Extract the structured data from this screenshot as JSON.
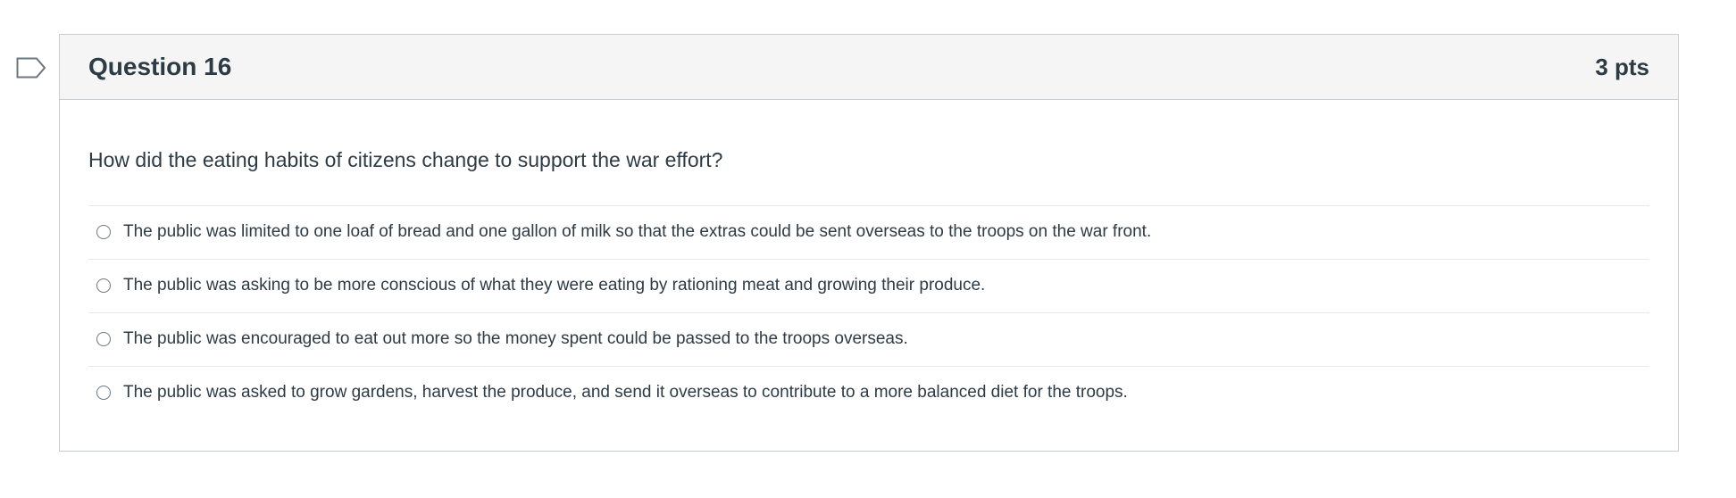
{
  "question": {
    "title": "Question 16",
    "points": "3 pts",
    "text": "How did the eating habits of citizens change to support the war effort?",
    "flag_icon": "flag-outline-icon",
    "answers": [
      {
        "label": "The public was limited to one loaf of bread and one gallon of milk so that the extras could be sent overseas to the troops on the war front.",
        "selected": false
      },
      {
        "label": "The public was asking to be more conscious of what they were eating by rationing meat and growing their produce.",
        "selected": false
      },
      {
        "label": "The public was encouraged to eat out more so the money spent could be passed to the troops overseas.",
        "selected": false
      },
      {
        "label": "The public was asked to grow gardens, harvest the produce, and send it overseas to contribute to a more balanced diet for the troops.",
        "selected": false
      }
    ]
  },
  "colors": {
    "text": "#2d3b45",
    "header_bg": "#f5f5f5",
    "border": "#c7cdd1",
    "divider": "#e6e8ea"
  }
}
